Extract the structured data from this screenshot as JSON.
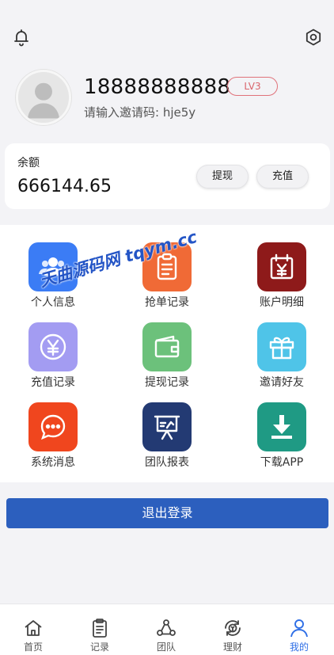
{
  "header": {
    "bell_icon": "bell-icon",
    "settings_icon": "settings-icon"
  },
  "profile": {
    "phone": "18888888888",
    "level": "LV3",
    "invite_label": "请输入邀请码: hje5y"
  },
  "balance": {
    "label": "余额",
    "value": "666144.65",
    "withdraw_label": "提现",
    "recharge_label": "充值"
  },
  "menu": [
    {
      "label": "个人信息",
      "icon": "users-icon",
      "color": "#3b7cf5"
    },
    {
      "label": "抢单记录",
      "icon": "clipboard-icon",
      "color": "#f06a36"
    },
    {
      "label": "账户明细",
      "icon": "calendar-yen-icon",
      "color": "#8e1a1a"
    },
    {
      "label": "充值记录",
      "icon": "yen-coin-icon",
      "color": "#a39cf2"
    },
    {
      "label": "提现记录",
      "icon": "wallet-icon",
      "color": "#6cc17b"
    },
    {
      "label": "邀请好友",
      "icon": "gift-icon",
      "color": "#4fc4e8"
    },
    {
      "label": "系统消息",
      "icon": "chat-icon",
      "color": "#f0461e"
    },
    {
      "label": "团队报表",
      "icon": "presentation-icon",
      "color": "#233a73"
    },
    {
      "label": "下载APP",
      "icon": "download-icon",
      "color": "#1f9a84"
    }
  ],
  "watermark": "天曲源码网 tqym.cc",
  "logout_label": "退出登录",
  "tabs": [
    {
      "label": "首页",
      "icon": "home-icon"
    },
    {
      "label": "记录",
      "icon": "records-icon"
    },
    {
      "label": "团队",
      "icon": "team-icon"
    },
    {
      "label": "理财",
      "icon": "finance-icon"
    },
    {
      "label": "我的",
      "icon": "profile-icon",
      "active": true
    }
  ],
  "colors": {
    "accent": "#2c5fbe",
    "tab_active": "#2f6fe6",
    "level_border": "#e0727a"
  }
}
